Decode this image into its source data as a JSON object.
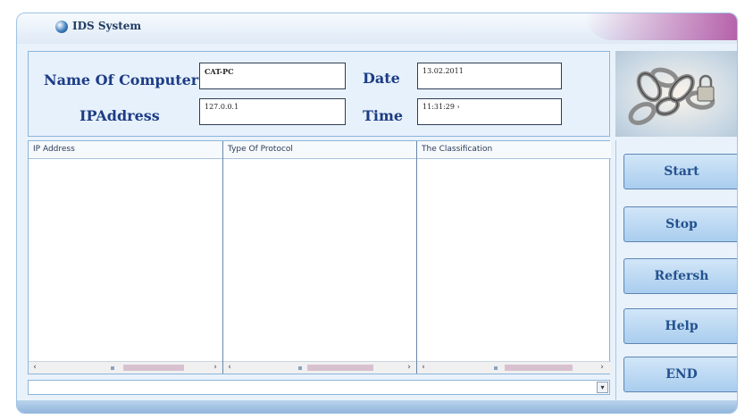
{
  "window": {
    "title": "IDS System"
  },
  "info": {
    "computer_name_label": "Name Of Computer",
    "computer_name_value": "CAT-PC",
    "ip_label": "IPAddress",
    "ip_value": "127.0.0.1",
    "date_label": "Date",
    "date_value": "13.02.2011",
    "time_label": "Time",
    "time_value": "11:31:29 ›"
  },
  "table": {
    "columns": [
      "IP Address",
      "Type Of Protocol",
      "The Classification"
    ],
    "rows": []
  },
  "buttons": {
    "start": "Start",
    "stop": "Stop",
    "refresh": "Refersh",
    "help": "Help",
    "end": "END"
  },
  "icons": {
    "title": "app-globe-icon",
    "image": "chain-lock-image",
    "scroll_left": "‹",
    "scroll_right": "›",
    "dropdown": "▾"
  },
  "colors": {
    "label": "#1c3c86",
    "button_text": "#24528f",
    "accent": "#b45aa6"
  }
}
